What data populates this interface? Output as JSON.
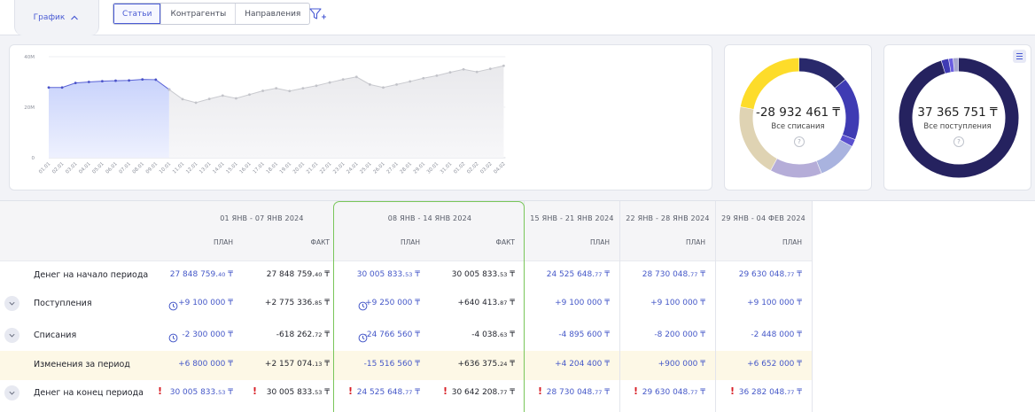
{
  "toolbar": {
    "grafik_tab": "График",
    "segments": [
      "Статьи",
      "Контрагенты",
      "Направления"
    ]
  },
  "colors": {
    "accent": "#4a5bd4",
    "positive_border": "#79c65a",
    "warning": "#d81f26",
    "highlight_row": "#fdf8e6"
  },
  "chart_data": {
    "type": "area",
    "categories": [
      "01.01",
      "02.01",
      "03.01",
      "04.01",
      "05.01",
      "06.01",
      "07.01",
      "08.01",
      "09.01",
      "10.01",
      "11.01",
      "12.01",
      "13.01",
      "14.01",
      "15.01",
      "16.01",
      "17.01",
      "18.01",
      "19.01",
      "20.01",
      "21.01",
      "22.01",
      "23.01",
      "24.01",
      "25.01",
      "26.01",
      "27.01",
      "28.01",
      "29.01",
      "30.01",
      "31.01",
      "01.02",
      "02.02",
      "03.02",
      "04.02"
    ],
    "y_tick_labels": [
      "40M",
      "20M",
      "0"
    ],
    "ylim": [
      0,
      40
    ],
    "series": [
      {
        "values": [
          27.8,
          27.8,
          29.6,
          30.0,
          30.3,
          30.5,
          30.6,
          31.0,
          30.9,
          27.0
        ]
      },
      {
        "values": [
          null,
          null,
          null,
          null,
          null,
          null,
          null,
          null,
          null,
          27.0,
          23.2,
          21.8,
          23.3,
          24.6,
          23.5,
          25.0,
          26.5,
          27.5,
          26.4,
          27.5,
          28.5,
          29.8,
          31.0,
          32.0,
          29.0,
          27.8,
          29.0,
          30.2,
          31.5,
          32.5,
          33.8,
          35.0,
          34.0,
          35.2,
          36.4
        ]
      }
    ],
    "grid": true
  },
  "donuts": [
    {
      "value": "-28 932 461 ₸",
      "label": "Все списания",
      "help": "?",
      "segments": [
        {
          "value": 14,
          "color": "#29296b"
        },
        {
          "value": 17,
          "color": "#3f3bb3"
        },
        {
          "value": 2,
          "color": "#5a50cf"
        },
        {
          "value": 11,
          "color": "#a9b3df"
        },
        {
          "value": 14,
          "color": "#b5add8"
        },
        {
          "value": 20,
          "color": "#dfd3b3"
        },
        {
          "value": 22,
          "color": "#fddc2a"
        }
      ]
    },
    {
      "value": "37 365 751 ₸",
      "label": "Все поступления",
      "help": "?",
      "segments": [
        {
          "value": 95.3,
          "color": "#25225f"
        },
        {
          "value": 2.0,
          "color": "#3f3bb3"
        },
        {
          "value": 1.2,
          "color": "#6a5de0"
        },
        {
          "value": 1.5,
          "color": "#a6a6ce"
        }
      ]
    }
  ],
  "table": {
    "periods": [
      {
        "title": "01 ЯНВ - 07 ЯНВ 2024",
        "cols": [
          "ПЛАН",
          "ФАКТ"
        ]
      },
      {
        "title": "08 ЯНВ - 14 ЯНВ 2024",
        "cols": [
          "ПЛАН",
          "ФАКТ"
        ]
      },
      {
        "title": "15 ЯНВ - 21 ЯНВ 2024",
        "cols": [
          "ПЛАН"
        ]
      },
      {
        "title": "22 ЯНВ - 28 ЯНВ 2024",
        "cols": [
          "ПЛАН"
        ]
      },
      {
        "title": "29 ЯНВ - 04 ФЕВ 2024",
        "cols": [
          "ПЛАН"
        ]
      }
    ],
    "rows": [
      {
        "label": "Денег на начало периода",
        "cells": [
          {
            "main": "27 848 759.",
            "dec": "40",
            "cur": " ₸"
          },
          {
            "main": "27 848 759.",
            "dec": "40",
            "cur": " ₸"
          },
          {
            "main": "30 005 833.",
            "dec": "53",
            "cur": " ₸"
          },
          {
            "main": "30 005 833.",
            "dec": "53",
            "cur": " ₸"
          },
          {
            "main": "24 525 648.",
            "dec": "77",
            "cur": " ₸"
          },
          {
            "main": "28 730 048.",
            "dec": "77",
            "cur": " ₸"
          },
          {
            "main": "29 630 048.",
            "dec": "77",
            "cur": " ₸"
          }
        ]
      },
      {
        "label": "Поступления",
        "cells": [
          {
            "main": "+9 100 000 ₸"
          },
          {
            "main": "+2 775 336.",
            "dec": "85",
            "cur": " ₸"
          },
          {
            "main": "+9 250 000 ₸"
          },
          {
            "main": "+640 413.",
            "dec": "87",
            "cur": " ₸"
          },
          {
            "main": "+9 100 000 ₸"
          },
          {
            "main": "+9 100 000 ₸"
          },
          {
            "main": "+9 100 000 ₸"
          }
        ]
      },
      {
        "label": "Списания",
        "cells": [
          {
            "main": "-2 300 000 ₸"
          },
          {
            "main": "-618 262.",
            "dec": "72",
            "cur": " ₸"
          },
          {
            "main": "-24 766 560 ₸"
          },
          {
            "main": "-4 038.",
            "dec": "63",
            "cur": " ₸"
          },
          {
            "main": "-4 895 600 ₸"
          },
          {
            "main": "-8 200 000 ₸"
          },
          {
            "main": "-2 448 000 ₸"
          }
        ]
      },
      {
        "label": "Изменения за период",
        "cells": [
          {
            "main": "+6 800 000 ₸"
          },
          {
            "main": "+2 157 074.",
            "dec": "13",
            "cur": " ₸"
          },
          {
            "main": "-15 516 560 ₸"
          },
          {
            "main": "+636 375.",
            "dec": "24",
            "cur": " ₸"
          },
          {
            "main": "+4 204 400 ₸"
          },
          {
            "main": "+900 000 ₸"
          },
          {
            "main": "+6 652 000 ₸"
          }
        ]
      },
      {
        "label": "Денег на конец периода",
        "cells": [
          {
            "main": "30 005 833.",
            "dec": "53",
            "cur": " ₸"
          },
          {
            "main": "30 005 833.",
            "dec": "53",
            "cur": " ₸"
          },
          {
            "main": "24 525 648.",
            "dec": "77",
            "cur": " ₸"
          },
          {
            "main": "30 642 208.",
            "dec": "77",
            "cur": " ₸"
          },
          {
            "main": "28 730 048.",
            "dec": "77",
            "cur": " ₸"
          },
          {
            "main": "29 630 048.",
            "dec": "77",
            "cur": " ₸"
          },
          {
            "main": "36 282 048.",
            "dec": "77",
            "cur": " ₸"
          }
        ]
      }
    ],
    "warning_mark": "!"
  }
}
